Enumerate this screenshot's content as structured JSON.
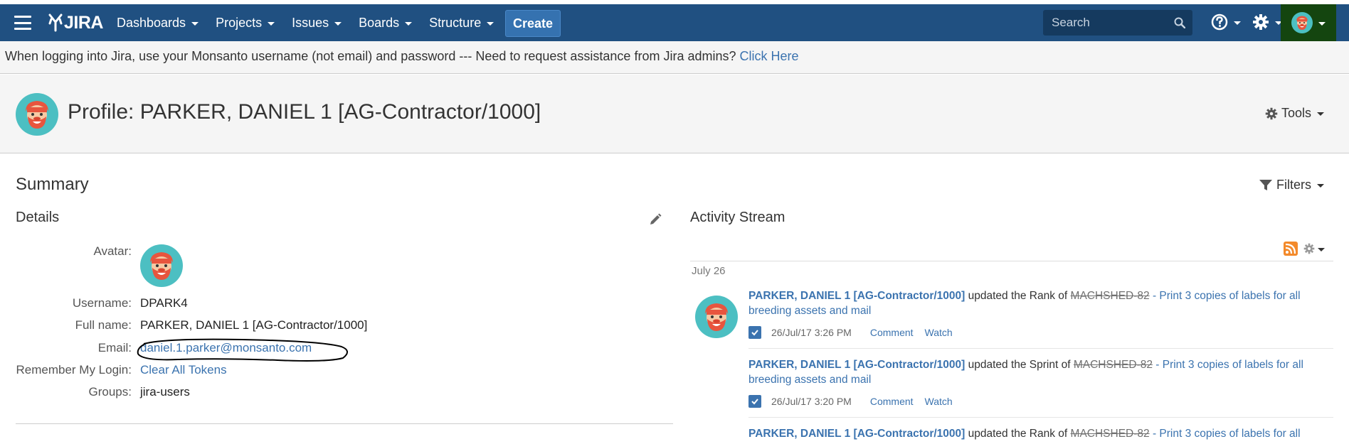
{
  "header": {
    "logo_text": "JIRA",
    "nav": [
      {
        "label": "Dashboards"
      },
      {
        "label": "Projects"
      },
      {
        "label": "Issues"
      },
      {
        "label": "Boards"
      },
      {
        "label": "Structure"
      }
    ],
    "create_label": "Create",
    "search_placeholder": "Search",
    "colors": {
      "bar": "#205081",
      "create": "#3572b0",
      "user_highlight": "#14450f"
    }
  },
  "announcement": {
    "text": "When logging into Jira, use your Monsanto username (not email) and password --- Need to request assistance from Jira admins? ",
    "link": "Click Here"
  },
  "page": {
    "title": "Profile: PARKER, DANIEL 1 [AG-Contractor/1000]",
    "tools_label": "Tools"
  },
  "summary": {
    "title": "Summary",
    "filters_label": "Filters"
  },
  "details": {
    "title": "Details",
    "avatar_label": "Avatar:",
    "username_label": "Username:",
    "username": "DPARK4",
    "fullname_label": "Full name:",
    "fullname": "PARKER, DANIEL 1 [AG-Contractor/1000]",
    "email_label": "Email:",
    "email": "daniel.1.parker@monsanto.com",
    "remember_label": "Remember My Login:",
    "remember_link": "Clear All Tokens",
    "groups_label": "Groups:",
    "groups": "jira-users"
  },
  "activity": {
    "title": "Activity Stream",
    "date": "July 26",
    "entries": [
      {
        "user": "PARKER, DANIEL 1 [AG-Contractor/1000]",
        "action": " updated the Rank of ",
        "issue_key": "MACHSHED-82",
        "issue_summary": " - Print 3 copies of labels for all breeding assets and mail",
        "timestamp": "26/Jul/17 3:26 PM",
        "comment": "Comment",
        "watch": "Watch"
      },
      {
        "user": "PARKER, DANIEL 1 [AG-Contractor/1000]",
        "action": " updated the Sprint of ",
        "issue_key": "MACHSHED-82",
        "issue_summary": " - Print 3 copies of labels for all breeding assets and mail",
        "timestamp": "26/Jul/17 3:20 PM",
        "comment": "Comment",
        "watch": "Watch"
      },
      {
        "user": "PARKER, DANIEL 1 [AG-Contractor/1000]",
        "action": " updated the Rank of ",
        "issue_key": "MACHSHED-82",
        "issue_summary": " - Print 3 copies of labels for all",
        "timestamp": "",
        "comment": "",
        "watch": ""
      }
    ]
  }
}
